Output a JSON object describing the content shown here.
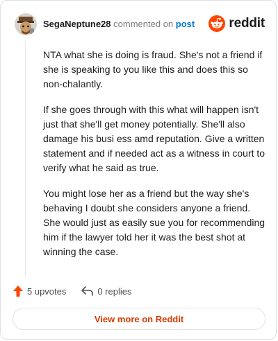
{
  "header": {
    "username": "SegaNeptune28",
    "verb": "commented on",
    "post_link": "post",
    "brand_name": "reddit"
  },
  "comment": {
    "paragraphs": [
      "NTA what she is doing is fraud. She's not a friend if she is speaking to you like this and does this so non-chalantly.",
      "If she goes through with this what will happen isn't just that she'll get money potentially. She'll also damage his busi ess amd reputation. Give a written statement and if needed act as a witness in court to verify what he said as true.",
      "You might lose her as a friend but the way she's behaving I doubt she considers anyone a friend. She would just as easily sue you for recommending him if the lawyer told her it was the best shot at winning the case."
    ]
  },
  "actions": {
    "upvotes_label": "5 upvotes",
    "replies_label": "0 replies"
  },
  "view_more_label": "View more on Reddit",
  "icons": {
    "avatar": "avatar",
    "brand": "reddit-snoo-icon",
    "upvote": "upvote-arrow-icon",
    "reply": "reply-arrow-icon"
  },
  "colors": {
    "brand_orange": "#ff4500",
    "upvote_orange": "#ff4500",
    "link_blue": "#0079d3",
    "view_more_text": "#d93a00"
  }
}
